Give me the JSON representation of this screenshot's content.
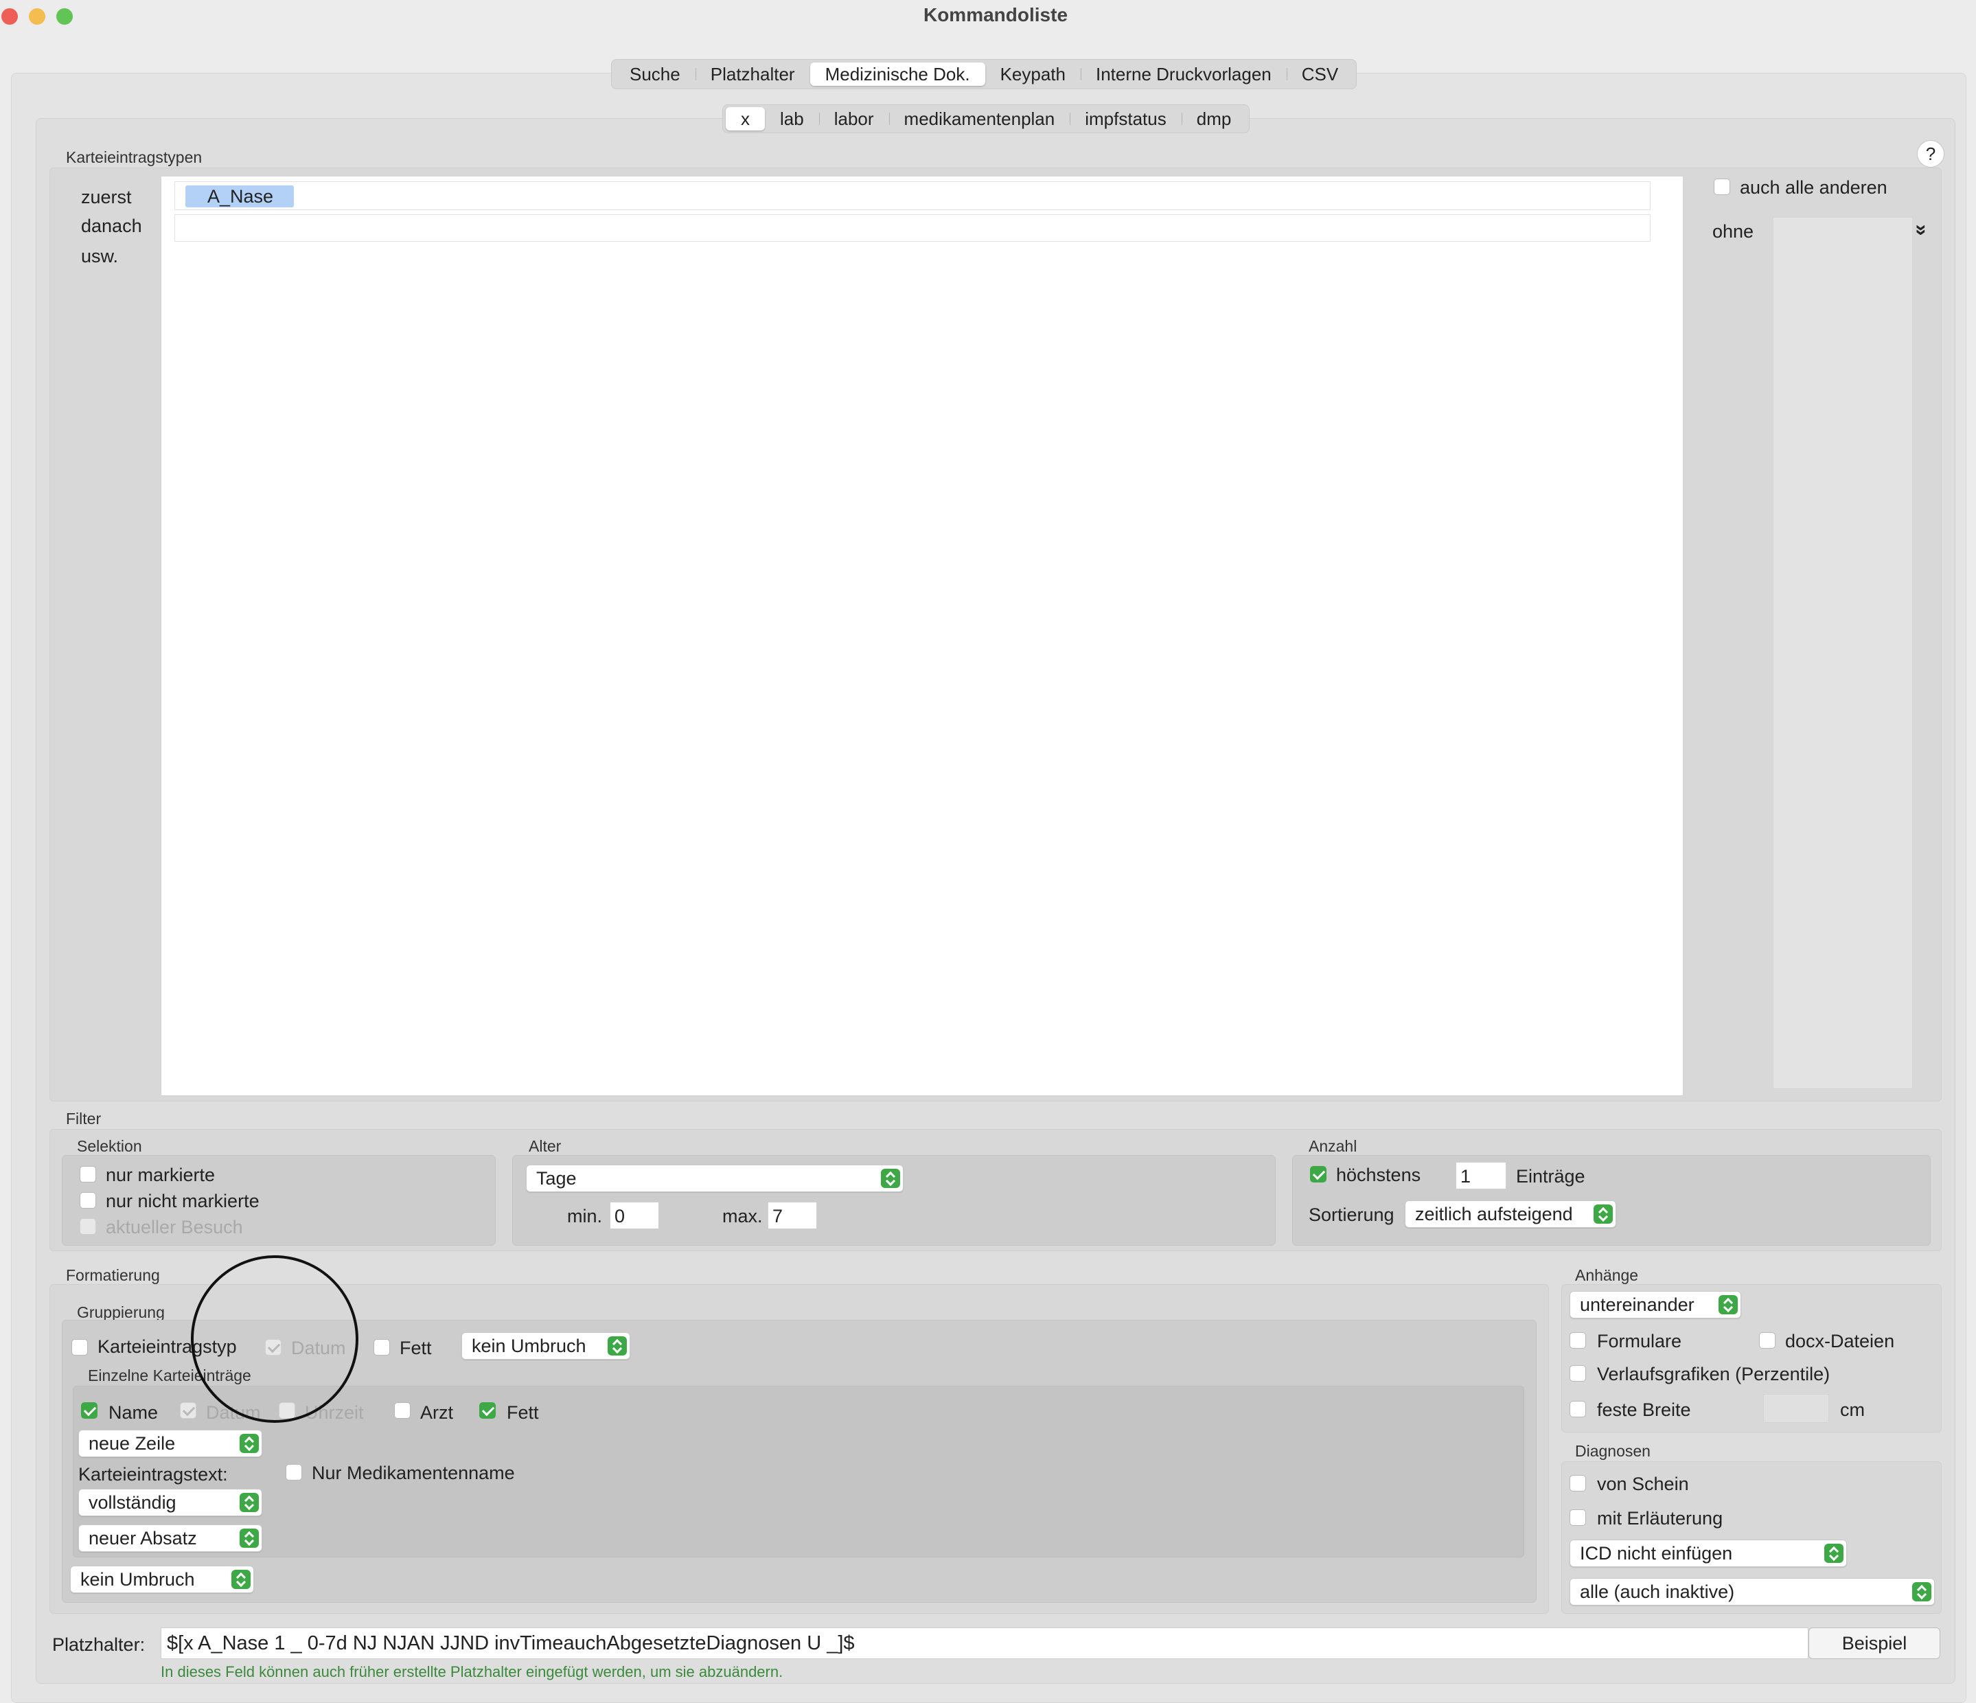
{
  "window": {
    "title": "Kommandoliste"
  },
  "main_tabs": [
    "Suche",
    "Platzhalter",
    "Medizinische Dok.",
    "Keypath",
    "Interne Druckvorlagen",
    "CSV"
  ],
  "main_tab_active": "Medizinische Dok.",
  "sub_tabs": [
    "x",
    "lab",
    "labor",
    "medikamentenplan",
    "impfstatus",
    "dmp"
  ],
  "sub_tab_active": "x",
  "karteieintragstypen": {
    "section_label": "Karteieintragstypen",
    "help_label": "?",
    "row_labels": [
      "zuerst",
      "danach",
      "usw."
    ],
    "first_entry": "A_Nase",
    "auch_alle_anderen": "auch alle anderen",
    "ohne": "ohne",
    "ohne_menu_glyph": "»"
  },
  "filter": {
    "section_label": "Filter",
    "selektion": {
      "label": "Selektion",
      "nur_markierte": "nur markierte",
      "nur_nicht_markierte": "nur nicht markierte",
      "aktueller_besuch": "aktueller Besuch"
    },
    "alter": {
      "label": "Alter",
      "unit": "Tage",
      "min_label": "min.",
      "min_value": "0",
      "max_label": "max.",
      "max_value": "7"
    },
    "anzahl": {
      "label": "Anzahl",
      "hoechstens": "höchstens",
      "count_value": "1",
      "eintraege": "Einträge",
      "sortierung_label": "Sortierung",
      "sortierung_value": "zeitlich aufsteigend"
    }
  },
  "formatierung": {
    "section_label": "Formatierung",
    "gruppierung": {
      "label": "Gruppierung",
      "karteieintragstyp": "Karteieintragstyp",
      "datum": "Datum",
      "fett": "Fett",
      "umbruch": "kein Umbruch"
    },
    "einzelne": {
      "label": "Einzelne Karteieinträge",
      "name": "Name",
      "datum": "Datum",
      "uhrzeit": "Uhrzeit",
      "arzt": "Arzt",
      "fett": "Fett",
      "zeile": "neue Zeile",
      "text_label": "Karteieintragstext:",
      "nur_medikamentenname": "Nur Medikamentenname",
      "text_mode": "vollständig",
      "absatz": "neuer Absatz"
    },
    "umbruch_bottom": "kein Umbruch"
  },
  "anhaenge": {
    "label": "Anhänge",
    "layout": "untereinander",
    "formulare": "Formulare",
    "docx": "docx-Dateien",
    "verlaufsgrafiken": "Verlaufsgrafiken (Perzentile)",
    "feste_breite": "feste Breite",
    "cm": "cm"
  },
  "diagnosen": {
    "label": "Diagnosen",
    "von_schein": "von Schein",
    "mit_erlaeuterung": "mit Erläuterung",
    "icd": "ICD nicht einfügen",
    "alle": "alle (auch inaktive)"
  },
  "platzhalter": {
    "label": "Platzhalter:",
    "value": "$[x A_Nase 1 _ 0-7d NJ NJAN JJND invTimeauchAbgesetzteDiagnosen U _]$",
    "button": "Beispiel",
    "hint": "In dieses Feld können auch früher erstellte Platzhalter eingefügt werden, um sie abzuändern."
  },
  "colors": {
    "accent": "#3ea846",
    "selection": "#b3d0f7",
    "hint_text": "#3b8a3b"
  }
}
